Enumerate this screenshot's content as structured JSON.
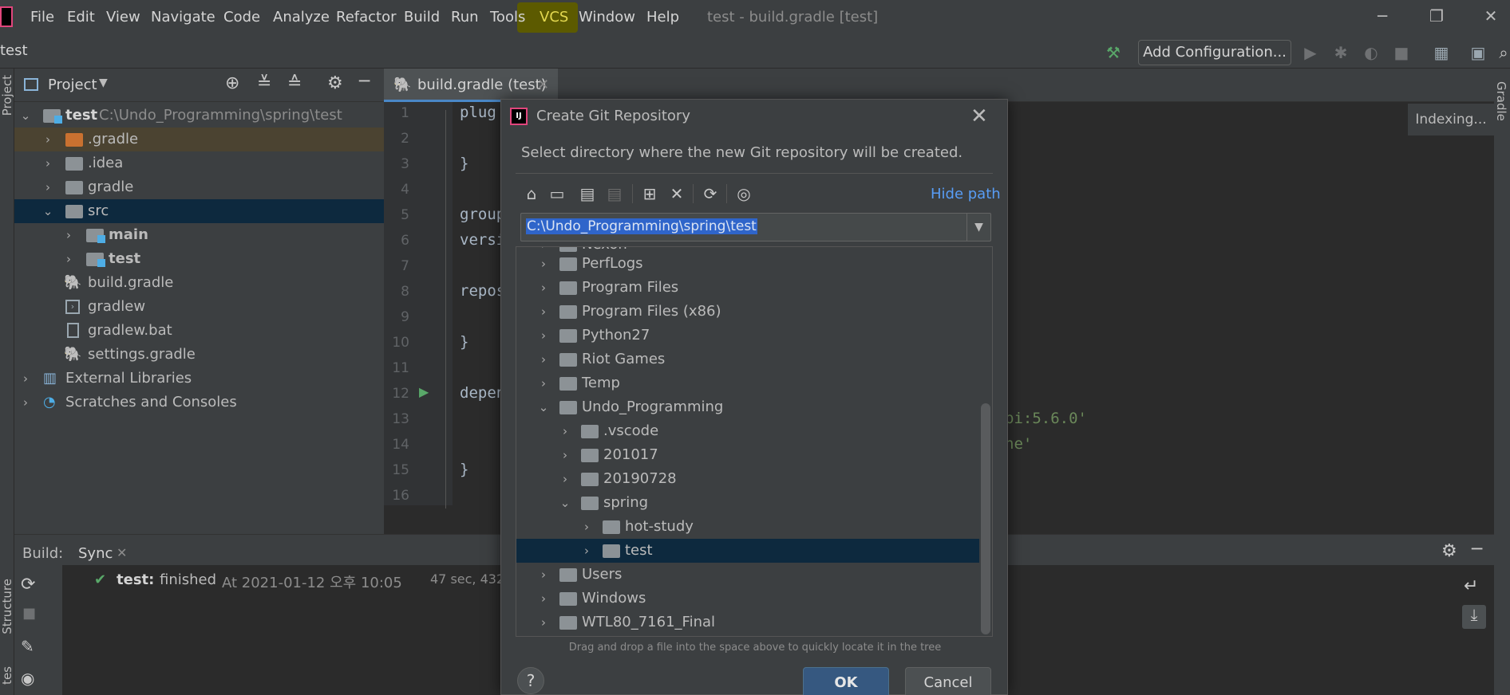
{
  "menubar": {
    "items": [
      "File",
      "Edit",
      "View",
      "Navigate",
      "Code",
      "Analyze",
      "Refactor",
      "Build",
      "Run",
      "Tools",
      "VCS",
      "Window",
      "Help"
    ],
    "window_title": "test - build.gradle [test]"
  },
  "toolbar": {
    "project_name": "test",
    "add_configuration": "Add Configuration..."
  },
  "project_panel": {
    "title": "Project",
    "strip_label": "Project",
    "tree": [
      {
        "label": "test",
        "path": "C:\\Undo_Programming\\spring\\test"
      },
      {
        "label": ".gradle"
      },
      {
        "label": ".idea"
      },
      {
        "label": "gradle"
      },
      {
        "label": "src"
      },
      {
        "label": "main"
      },
      {
        "label": "test"
      },
      {
        "label": "build.gradle"
      },
      {
        "label": "gradlew"
      },
      {
        "label": "gradlew.bat"
      },
      {
        "label": "settings.gradle"
      },
      {
        "label": "External Libraries"
      },
      {
        "label": "Scratches and Consoles"
      }
    ]
  },
  "editor": {
    "tab_label": "build.gradle (test)",
    "indexing": "Indexing...",
    "line_numbers": [
      "1",
      "2",
      "3",
      "4",
      "5",
      "6",
      "7",
      "8",
      "9",
      "10",
      "11",
      "12",
      "13",
      "14",
      "15",
      "16"
    ],
    "visible_code": {
      "l1": "plug",
      "l3": "}",
      "l5": "group",
      "l6": "versi",
      "l8": "repos",
      "l10": "}",
      "l12": "depen",
      "l13_tail": "pi:5.6.0'",
      "l14_tail": "ne'",
      "l15": "}"
    },
    "right_strip_label": "Gradle"
  },
  "build_panel": {
    "label": "Build:",
    "tab": "Sync",
    "status_name": "test:",
    "status_text": "finished",
    "status_time": "At 2021-01-12 오후 10:05",
    "duration": "47 sec, 432",
    "strip_labels": [
      "Structure",
      "tes"
    ]
  },
  "dialog": {
    "title": "Create Git Repository",
    "description": "Select directory where the new Git repository will be created.",
    "hide_path": "Hide path",
    "path_value": "C:\\Undo_Programming\\spring\\test",
    "tree": [
      {
        "label": "Nexon"
      },
      {
        "label": "PerfLogs"
      },
      {
        "label": "Program Files"
      },
      {
        "label": "Program Files (x86)"
      },
      {
        "label": "Python27"
      },
      {
        "label": "Riot Games"
      },
      {
        "label": "Temp"
      },
      {
        "label": "Undo_Programming"
      },
      {
        "label": ".vscode"
      },
      {
        "label": "201017"
      },
      {
        "label": "20190728"
      },
      {
        "label": "spring"
      },
      {
        "label": "hot-study"
      },
      {
        "label": "test"
      },
      {
        "label": "Users"
      },
      {
        "label": "Windows"
      },
      {
        "label": "WTL80_7161_Final"
      }
    ],
    "hint": "Drag and drop a file into the space above to quickly locate it in the tree",
    "help": "?",
    "ok": "OK",
    "cancel": "Cancel"
  }
}
